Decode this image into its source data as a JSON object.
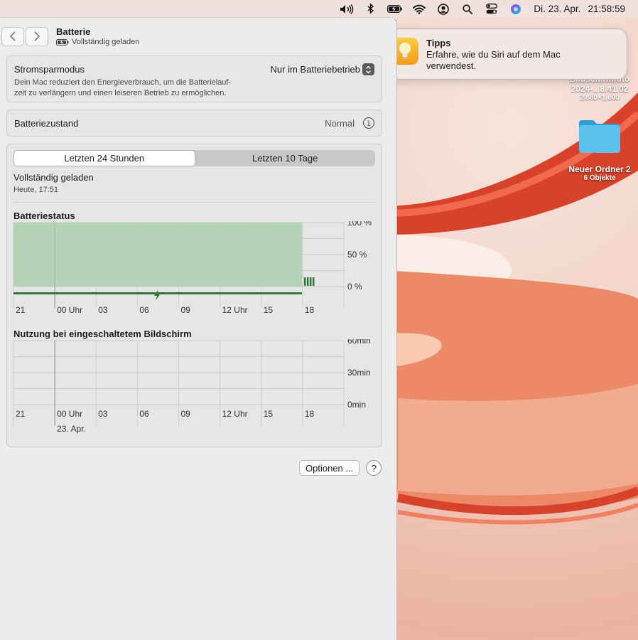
{
  "menubar": {
    "icons": [
      "speaker-icon",
      "bluetooth-icon",
      "battery-charging-icon",
      "wifi-icon",
      "user-account-icon",
      "spotlight-search-icon",
      "control-center-icon",
      "siri-icon"
    ],
    "date": "Di. 23. Apr.",
    "time": "21:58:59"
  },
  "window": {
    "title": "Batterie",
    "subtitle": "Vollständig geladen",
    "power_mode": {
      "label": "Stromsparmodus",
      "description": "Dein Mac reduziert den Energieverbrauch, um die Batterielauf-zeit zu verlängern und einen leiseren Betrieb zu ermöglichen.",
      "description_line1": "Dein Mac reduziert den Energieverbrauch, um die Batterielauf-",
      "description_line2": "zeit zu verlängern und einen leiseren Betrieb zu ermöglichen.",
      "selected": "Nur im Batteriebetrieb"
    },
    "health": {
      "label": "Batteriezustand",
      "value": "Normal"
    },
    "tabs": [
      "Letzten 24 Stunden",
      "Letzten 10 Tage"
    ],
    "active_tab": 0,
    "status": {
      "text": "Vollständig geladen",
      "time": "Heute, 17:51"
    },
    "battery_chart": {
      "title": "Batteriestatus",
      "y_ticks": [
        "100 %",
        "50 %",
        "0 %"
      ],
      "x_ticks": [
        "21",
        "00 Uhr",
        "03",
        "06",
        "09",
        "12 Uhr",
        "15",
        "18"
      ]
    },
    "screen_chart": {
      "title": "Nutzung bei eingeschaltetem Bildschirm",
      "y_ticks": [
        "60min",
        "30min",
        "0min"
      ],
      "x_ticks": [
        "21",
        "00 Uhr",
        "03",
        "06",
        "09",
        "12 Uhr",
        "15",
        "18"
      ],
      "date_label": "23. Apr."
    },
    "options_button": "Optionen ...",
    "help_button": "?"
  },
  "chart_data": [
    {
      "type": "area",
      "title": "Batteriestatus",
      "x_categories": [
        "21",
        "00 Uhr",
        "03",
        "06",
        "09",
        "12 Uhr",
        "15",
        "18"
      ],
      "y_unit": "%",
      "ylim": [
        0,
        100
      ],
      "series": [
        {
          "values": [
            100,
            100,
            100,
            100,
            100,
            100,
            100,
            100,
            100,
            100,
            100,
            100,
            100,
            100,
            100,
            100,
            100,
            100,
            100,
            100,
            100
          ],
          "charging_hours": 21
        }
      ],
      "grid": true
    },
    {
      "type": "bar",
      "title": "Nutzung bei eingeschaltetem Bildschirm",
      "x_categories": [
        "21",
        "00 Uhr",
        "03",
        "06",
        "09",
        "12 Uhr",
        "15",
        "18"
      ],
      "y_unit": "min",
      "ylim": [
        0,
        60
      ],
      "series": [
        {
          "values": []
        }
      ],
      "grid": true
    }
  ],
  "notification": {
    "app": "Tipps",
    "message": "Erfahre, wie du Siri auf dem Mac verwendest.",
    "message_line1": "Erfahre, wie du Siri auf dem Mac",
    "message_line2": "verwendest."
  },
  "desktop": {
    "screenshot": {
      "name": "Bildschirmfoto",
      "name2": "2024-...8.41.02",
      "size": "2.880×1.800"
    },
    "folder": {
      "name": "Neuer Ordner 2",
      "count": "6 Objekte"
    }
  },
  "colors": {
    "battery_fill": "#b3d3b7",
    "battery_line": "#2f7a36",
    "folder": "#4fb3e6"
  }
}
